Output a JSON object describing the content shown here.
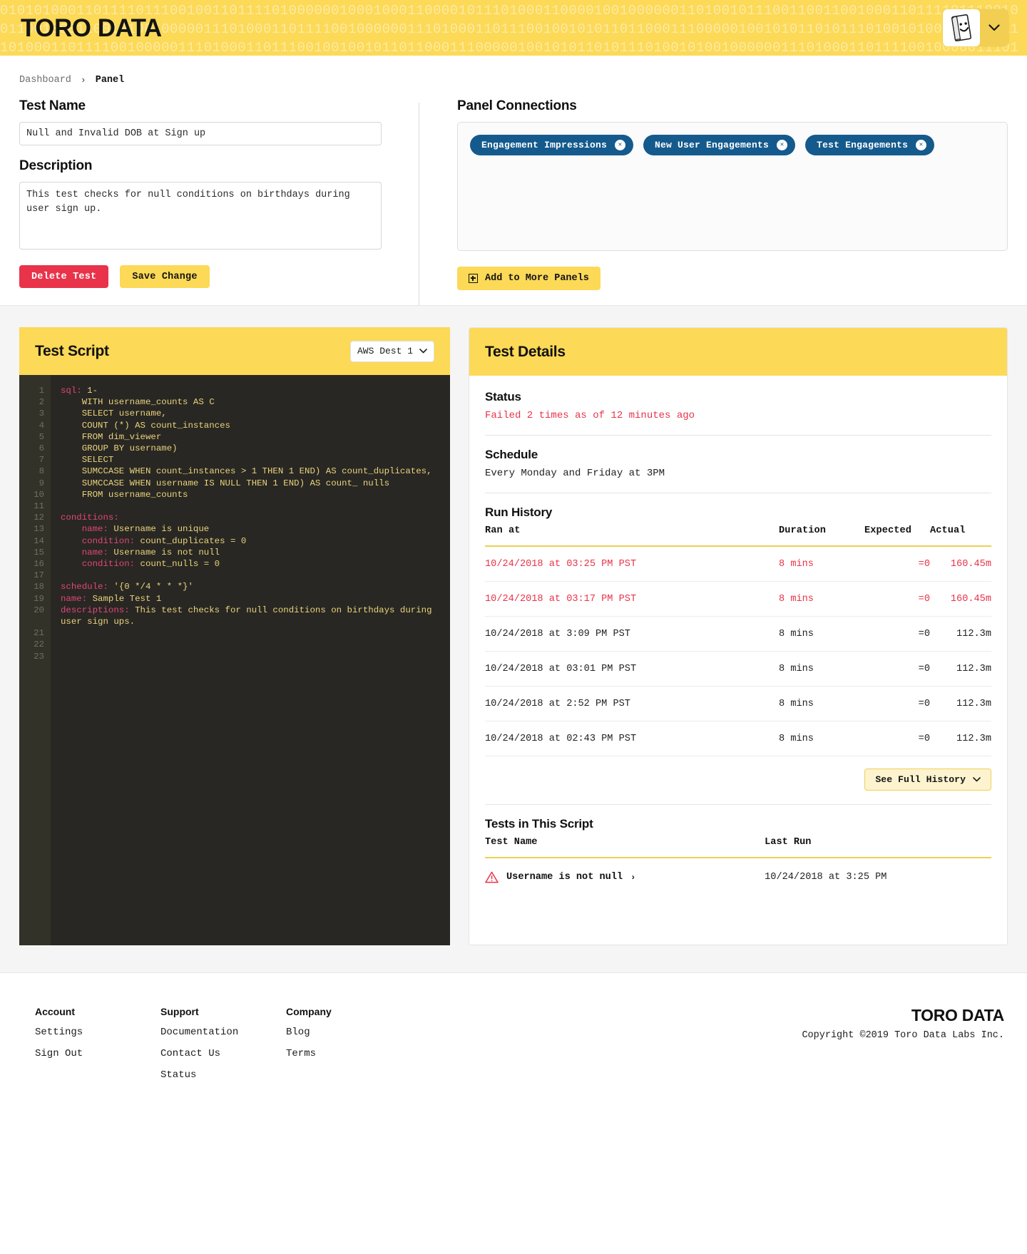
{
  "header": {
    "logo": "TORO DATA",
    "binary_pattern": "01010100011011110111001001101111010000001000100011000010111010001100001001000000110100101110011001100100011011110111001001100100011001010010000011101000110111100100000011101000110111001001010110110001110000010010101101011101001010010000001110100011011110010000011101000110111001001001011011000111000001001010110101110100101001000000111010001101111001000001110100011011100100101101100011100000100101011010111010010100100000011101000110111100100000111010001101110010010101101100011100000100101101011101001010010000001110100011011110"
  },
  "breadcrumb": {
    "root": "Dashboard",
    "separator": "›",
    "current": "Panel"
  },
  "form": {
    "test_name_label": "Test Name",
    "test_name_value": "Null and Invalid DOB at Sign up",
    "description_label": "Description",
    "description_value": "This test checks for null conditions on birthdays during user sign up.",
    "delete_label": "Delete Test",
    "save_label": "Save Change"
  },
  "panel_connections": {
    "title": "Panel Connections",
    "chips": [
      "Engagement Impressions",
      "New User Engagements",
      "Test Engagements"
    ],
    "add_button": "Add to More Panels"
  },
  "test_script": {
    "title": "Test Script",
    "destination": "AWS Dest 1",
    "line_count": 23,
    "code_lines": [
      {
        "n": 1,
        "key": "sql:",
        "text": " 1-"
      },
      {
        "n": 2,
        "key": "",
        "text": "    WITH username_counts AS C"
      },
      {
        "n": 3,
        "key": "",
        "text": "    SELECT username,"
      },
      {
        "n": 4,
        "key": "",
        "text": "    COUNT (*) AS count_instances"
      },
      {
        "n": 5,
        "key": "",
        "text": "    FROM dim_viewer"
      },
      {
        "n": 6,
        "key": "",
        "text": "    GROUP BY username)"
      },
      {
        "n": 7,
        "key": "",
        "text": "    SELECT"
      },
      {
        "n": 8,
        "key": "",
        "text": "    SUMCCASE WHEN count_instances > 1 THEN 1 END) AS count_duplicates,"
      },
      {
        "n": 9,
        "key": "",
        "text": "    SUMCCASE WHEN username IS NULL THEN 1 END) AS count_ nulls"
      },
      {
        "n": 10,
        "key": "",
        "text": "    FROM username_counts"
      },
      {
        "n": 11,
        "key": "",
        "text": ""
      },
      {
        "n": 12,
        "key": "conditions:",
        "text": ""
      },
      {
        "n": 13,
        "key": "    name:",
        "text": " Username is unique"
      },
      {
        "n": 14,
        "key": "    condition:",
        "text": " count_duplicates = 0"
      },
      {
        "n": 15,
        "key": "    name:",
        "text": " Username is not null"
      },
      {
        "n": 16,
        "key": "    condition:",
        "text": " count_nulls = 0"
      },
      {
        "n": 17,
        "key": "",
        "text": ""
      },
      {
        "n": 18,
        "key": "schedule:",
        "text": " '{0 */4 * * *}'"
      },
      {
        "n": 19,
        "key": "name:",
        "text": " Sample Test 1"
      },
      {
        "n": 20,
        "key": "descriptions:",
        "text": " This test checks for null conditions on birthdays during user sign ups."
      },
      {
        "n": 21,
        "key": "",
        "text": ""
      },
      {
        "n": 22,
        "key": "",
        "text": ""
      },
      {
        "n": 23,
        "key": "",
        "text": ""
      }
    ]
  },
  "test_details": {
    "title": "Test Details",
    "status_label": "Status",
    "status_value": "Failed 2 times as of 12 minutes ago",
    "schedule_label": "Schedule",
    "schedule_value": "Every Monday and Friday at 3PM",
    "run_history_label": "Run History",
    "run_history_columns": [
      "Ran at",
      "Duration",
      "Expected",
      "Actual"
    ],
    "run_history_rows": [
      {
        "ran_at": "10/24/2018 at 03:25 PM PST",
        "duration": "8 mins",
        "expected": "=0",
        "actual": "160.45m",
        "failed": true
      },
      {
        "ran_at": "10/24/2018 at 03:17 PM PST",
        "duration": "8 mins",
        "expected": "=0",
        "actual": "160.45m",
        "failed": true
      },
      {
        "ran_at": "10/24/2018 at 3:09 PM PST",
        "duration": "8 mins",
        "expected": "=0",
        "actual": "112.3m",
        "failed": false
      },
      {
        "ran_at": "10/24/2018 at 03:01 PM PST",
        "duration": "8 mins",
        "expected": "=0",
        "actual": "112.3m",
        "failed": false
      },
      {
        "ran_at": "10/24/2018 at 2:52 PM PST",
        "duration": "8 mins",
        "expected": "=0",
        "actual": "112.3m",
        "failed": false
      },
      {
        "ran_at": "10/24/2018 at 02:43 PM PST",
        "duration": "8 mins",
        "expected": "=0",
        "actual": "112.3m",
        "failed": false
      }
    ],
    "see_full_history": "See Full History",
    "tests_in_script_label": "Tests in This Script",
    "tests_columns": [
      "Test Name",
      "Last Run"
    ],
    "tests_rows": [
      {
        "name": "Username is not null",
        "last_run": "10/24/2018 at 3:25 PM"
      }
    ]
  },
  "footer": {
    "columns": [
      {
        "title": "Account",
        "links": [
          "Settings",
          "Sign Out"
        ]
      },
      {
        "title": "Support",
        "links": [
          "Documentation",
          "Contact Us",
          "Status"
        ]
      },
      {
        "title": "Company",
        "links": [
          "Blog",
          "Terms"
        ]
      }
    ],
    "logo": "TORO DATA",
    "copyright": "Copyright ©2019 Toro Data Labs Inc."
  },
  "colors": {
    "brand_yellow": "#fcd957",
    "danger_red": "#e8334a",
    "chip_blue": "#145a8d",
    "code_bg": "#282723"
  }
}
